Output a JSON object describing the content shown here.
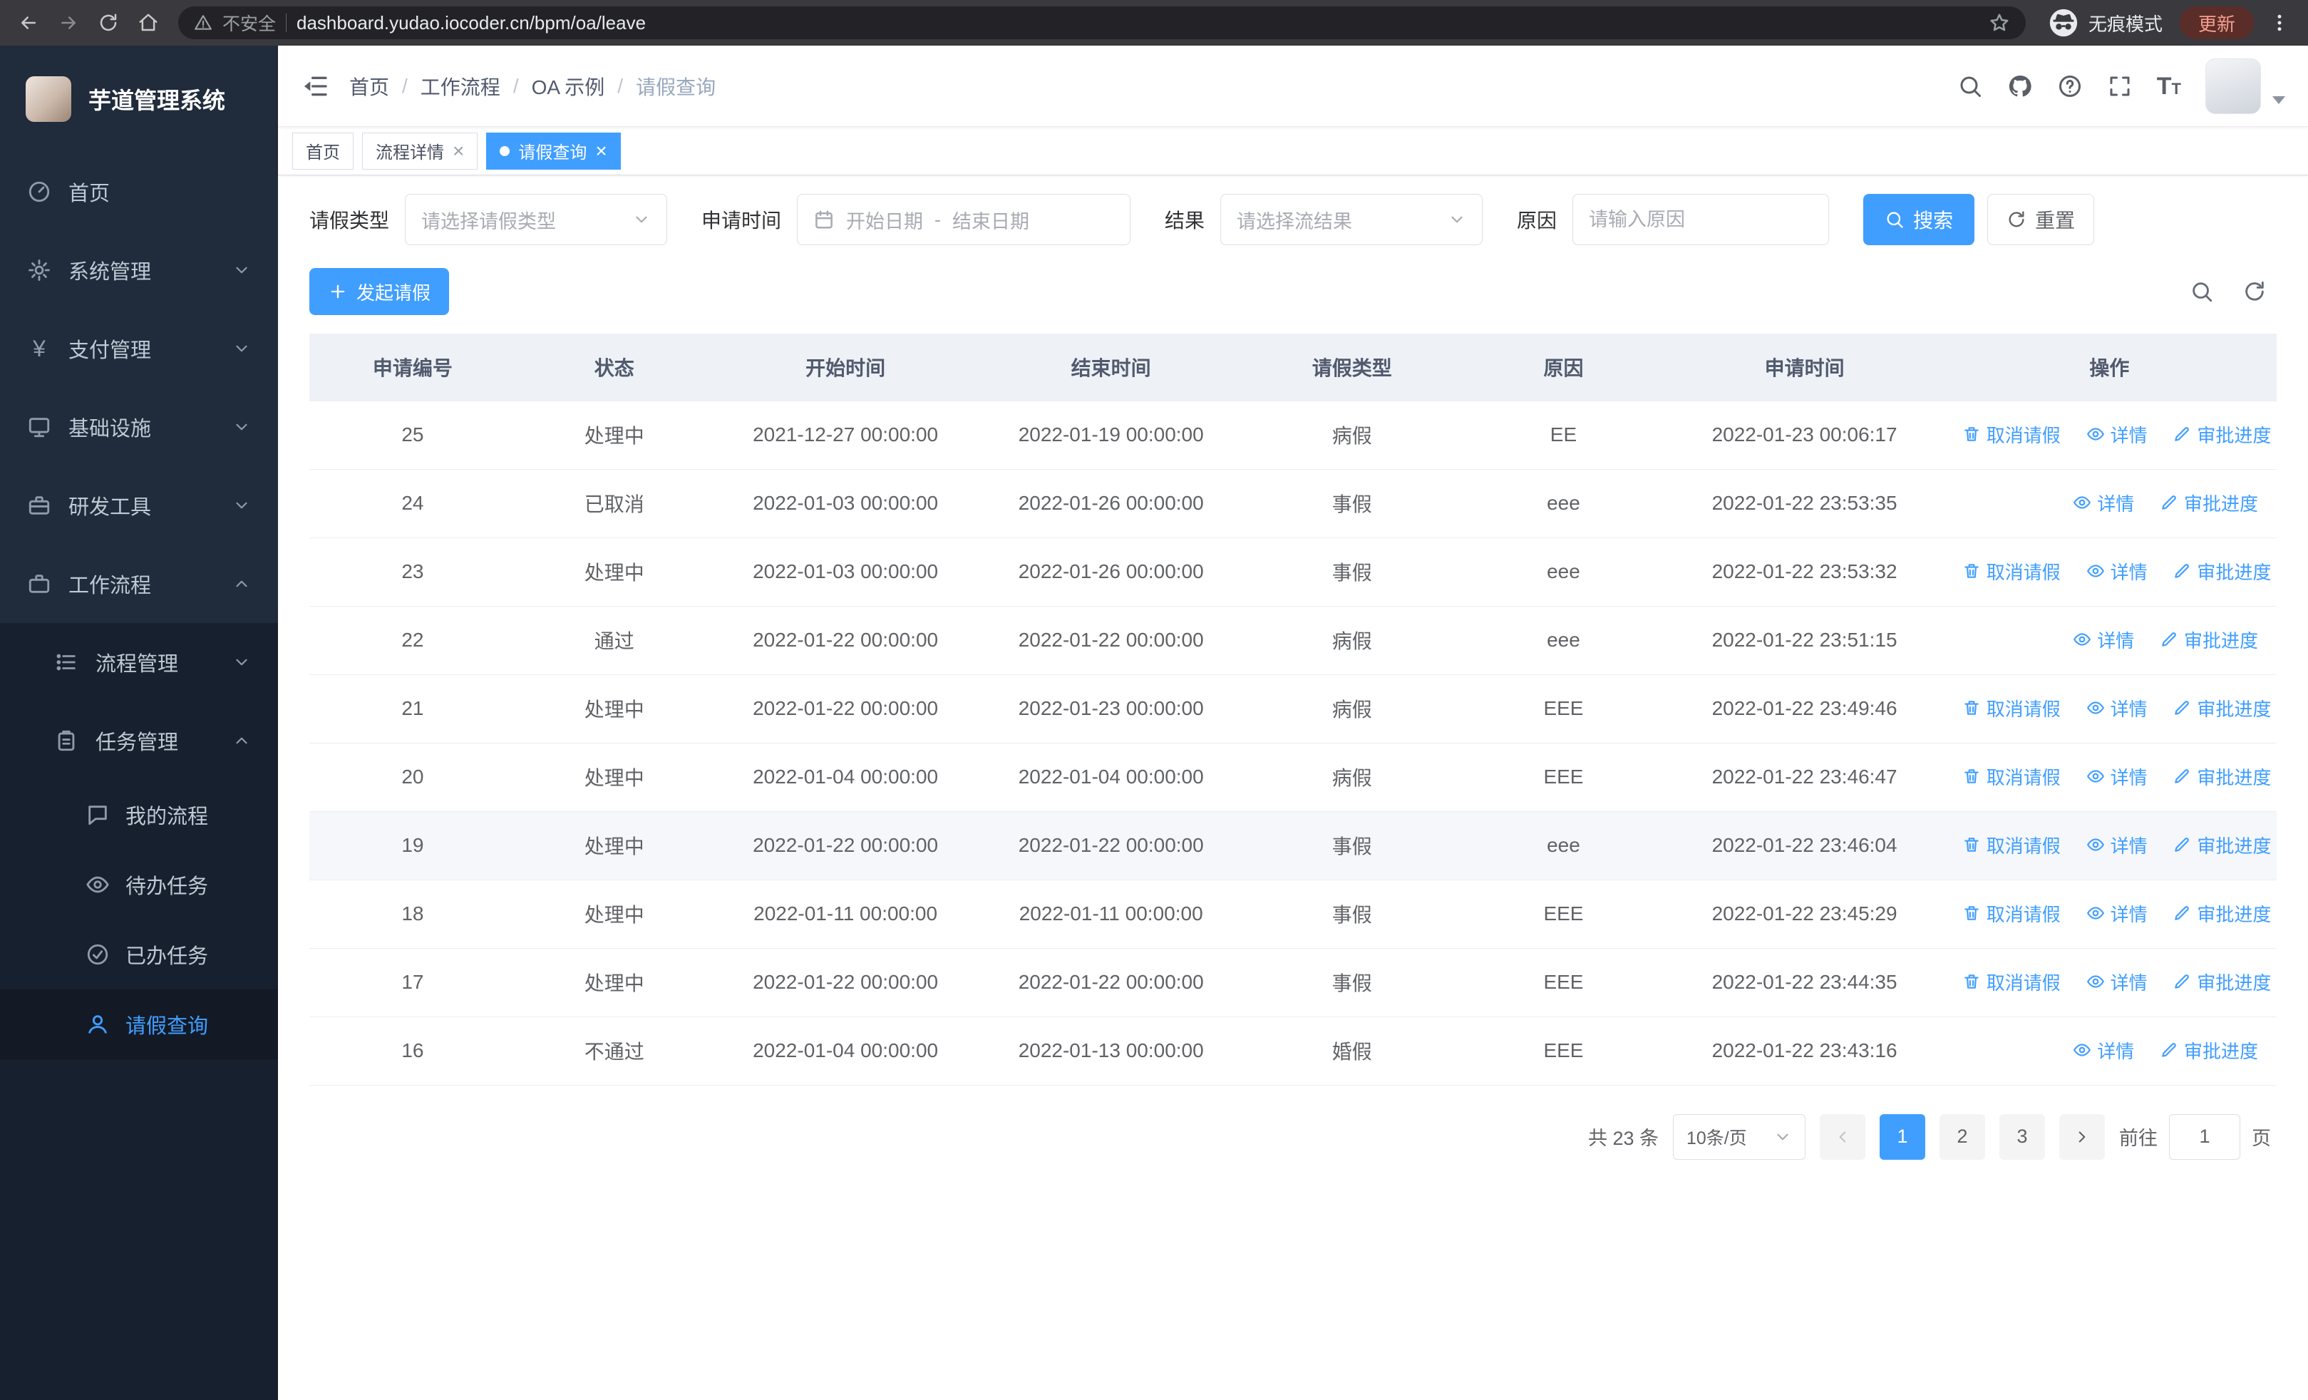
{
  "colors": {
    "accent": "#409eff",
    "danger": "#f56c6c",
    "sidebar_bg": "#17202e",
    "sidebar_top_bg": "#202b3b",
    "table_header_bg": "#eef1f6"
  },
  "browser": {
    "security_label": "不安全",
    "url": "dashboard.yudao.iocoder.cn/bpm/oa/leave",
    "incognito_label": "无痕模式",
    "update_label": "更新"
  },
  "sidebar": {
    "logo_title": "芋道管理系统",
    "items": [
      {
        "label": "首页",
        "icon": "dashboard-icon"
      },
      {
        "label": "系统管理",
        "icon": "gear-icon"
      },
      {
        "label": "支付管理",
        "icon": "yen-icon"
      },
      {
        "label": "基础设施",
        "icon": "monitor-icon"
      },
      {
        "label": "研发工具",
        "icon": "toolbox-icon"
      },
      {
        "label": "工作流程",
        "icon": "briefcase-icon"
      },
      {
        "label": "流程管理",
        "icon": "list-icon"
      },
      {
        "label": "任务管理",
        "icon": "clipboard-icon"
      },
      {
        "label": "我的流程",
        "icon": "chat-icon"
      },
      {
        "label": "待办任务",
        "icon": "eye-icon"
      },
      {
        "label": "已办任务",
        "icon": "check-icon"
      },
      {
        "label": "请假查询",
        "icon": "user-icon"
      }
    ]
  },
  "icons": {
    "yen_glyph": "¥"
  },
  "header": {
    "breadcrumb": [
      "首页",
      "工作流程",
      "OA 示例",
      "请假查询"
    ],
    "separator": "/"
  },
  "tabs": {
    "close_glyph": "×",
    "items": [
      {
        "label": "首页"
      },
      {
        "label": "流程详情"
      },
      {
        "label": "请假查询"
      }
    ]
  },
  "filters": {
    "leave_type_label": "请假类型",
    "leave_type_placeholder": "请选择请假类型",
    "apply_time_label": "申请时间",
    "start_date_placeholder": "开始日期",
    "range_separator": "-",
    "end_date_placeholder": "结束日期",
    "result_label": "结果",
    "result_placeholder": "请选择流结果",
    "reason_label": "原因",
    "reason_placeholder": "请输入原因",
    "search_label": "搜索",
    "reset_label": "重置"
  },
  "toolbar": {
    "create_label": "发起请假"
  },
  "table": {
    "columns": [
      "申请编号",
      "状态",
      "开始时间",
      "结束时间",
      "请假类型",
      "原因",
      "申请时间",
      "操作"
    ],
    "actions": {
      "cancel": "取消请假",
      "detail": "详情",
      "progress": "审批进度"
    },
    "rows": [
      {
        "id": "25",
        "status": "处理中",
        "start": "2021-12-27 00:00:00",
        "end": "2022-01-19 00:00:00",
        "type": "病假",
        "reason": "EE",
        "applied": "2022-01-23 00:06:17",
        "can_cancel": true,
        "highlighted": false
      },
      {
        "id": "24",
        "status": "已取消",
        "start": "2022-01-03 00:00:00",
        "end": "2022-01-26 00:00:00",
        "type": "事假",
        "reason": "eee",
        "applied": "2022-01-22 23:53:35",
        "can_cancel": false,
        "highlighted": false
      },
      {
        "id": "23",
        "status": "处理中",
        "start": "2022-01-03 00:00:00",
        "end": "2022-01-26 00:00:00",
        "type": "事假",
        "reason": "eee",
        "applied": "2022-01-22 23:53:32",
        "can_cancel": true,
        "highlighted": false
      },
      {
        "id": "22",
        "status": "通过",
        "start": "2022-01-22 00:00:00",
        "end": "2022-01-22 00:00:00",
        "type": "病假",
        "reason": "eee",
        "applied": "2022-01-22 23:51:15",
        "can_cancel": false,
        "highlighted": false
      },
      {
        "id": "21",
        "status": "处理中",
        "start": "2022-01-22 00:00:00",
        "end": "2022-01-23 00:00:00",
        "type": "病假",
        "reason": "EEE",
        "applied": "2022-01-22 23:49:46",
        "can_cancel": true,
        "highlighted": false
      },
      {
        "id": "20",
        "status": "处理中",
        "start": "2022-01-04 00:00:00",
        "end": "2022-01-04 00:00:00",
        "type": "病假",
        "reason": "EEE",
        "applied": "2022-01-22 23:46:47",
        "can_cancel": true,
        "highlighted": false
      },
      {
        "id": "19",
        "status": "处理中",
        "start": "2022-01-22 00:00:00",
        "end": "2022-01-22 00:00:00",
        "type": "事假",
        "reason": "eee",
        "applied": "2022-01-22 23:46:04",
        "can_cancel": true,
        "highlighted": true
      },
      {
        "id": "18",
        "status": "处理中",
        "start": "2022-01-11 00:00:00",
        "end": "2022-01-11 00:00:00",
        "type": "事假",
        "reason": "EEE",
        "applied": "2022-01-22 23:45:29",
        "can_cancel": true,
        "highlighted": false
      },
      {
        "id": "17",
        "status": "处理中",
        "start": "2022-01-22 00:00:00",
        "end": "2022-01-22 00:00:00",
        "type": "事假",
        "reason": "EEE",
        "applied": "2022-01-22 23:44:35",
        "can_cancel": true,
        "highlighted": false
      },
      {
        "id": "16",
        "status": "不通过",
        "start": "2022-01-04 00:00:00",
        "end": "2022-01-13 00:00:00",
        "type": "婚假",
        "reason": "EEE",
        "applied": "2022-01-22 23:43:16",
        "can_cancel": false,
        "highlighted": false
      }
    ]
  },
  "pagination": {
    "total_text": "共 23 条",
    "page_size_text": "10条/页",
    "pages": [
      "1",
      "2",
      "3"
    ],
    "active_page": "1",
    "goto_prefix": "前往",
    "goto_value": "1",
    "goto_suffix": "页"
  }
}
